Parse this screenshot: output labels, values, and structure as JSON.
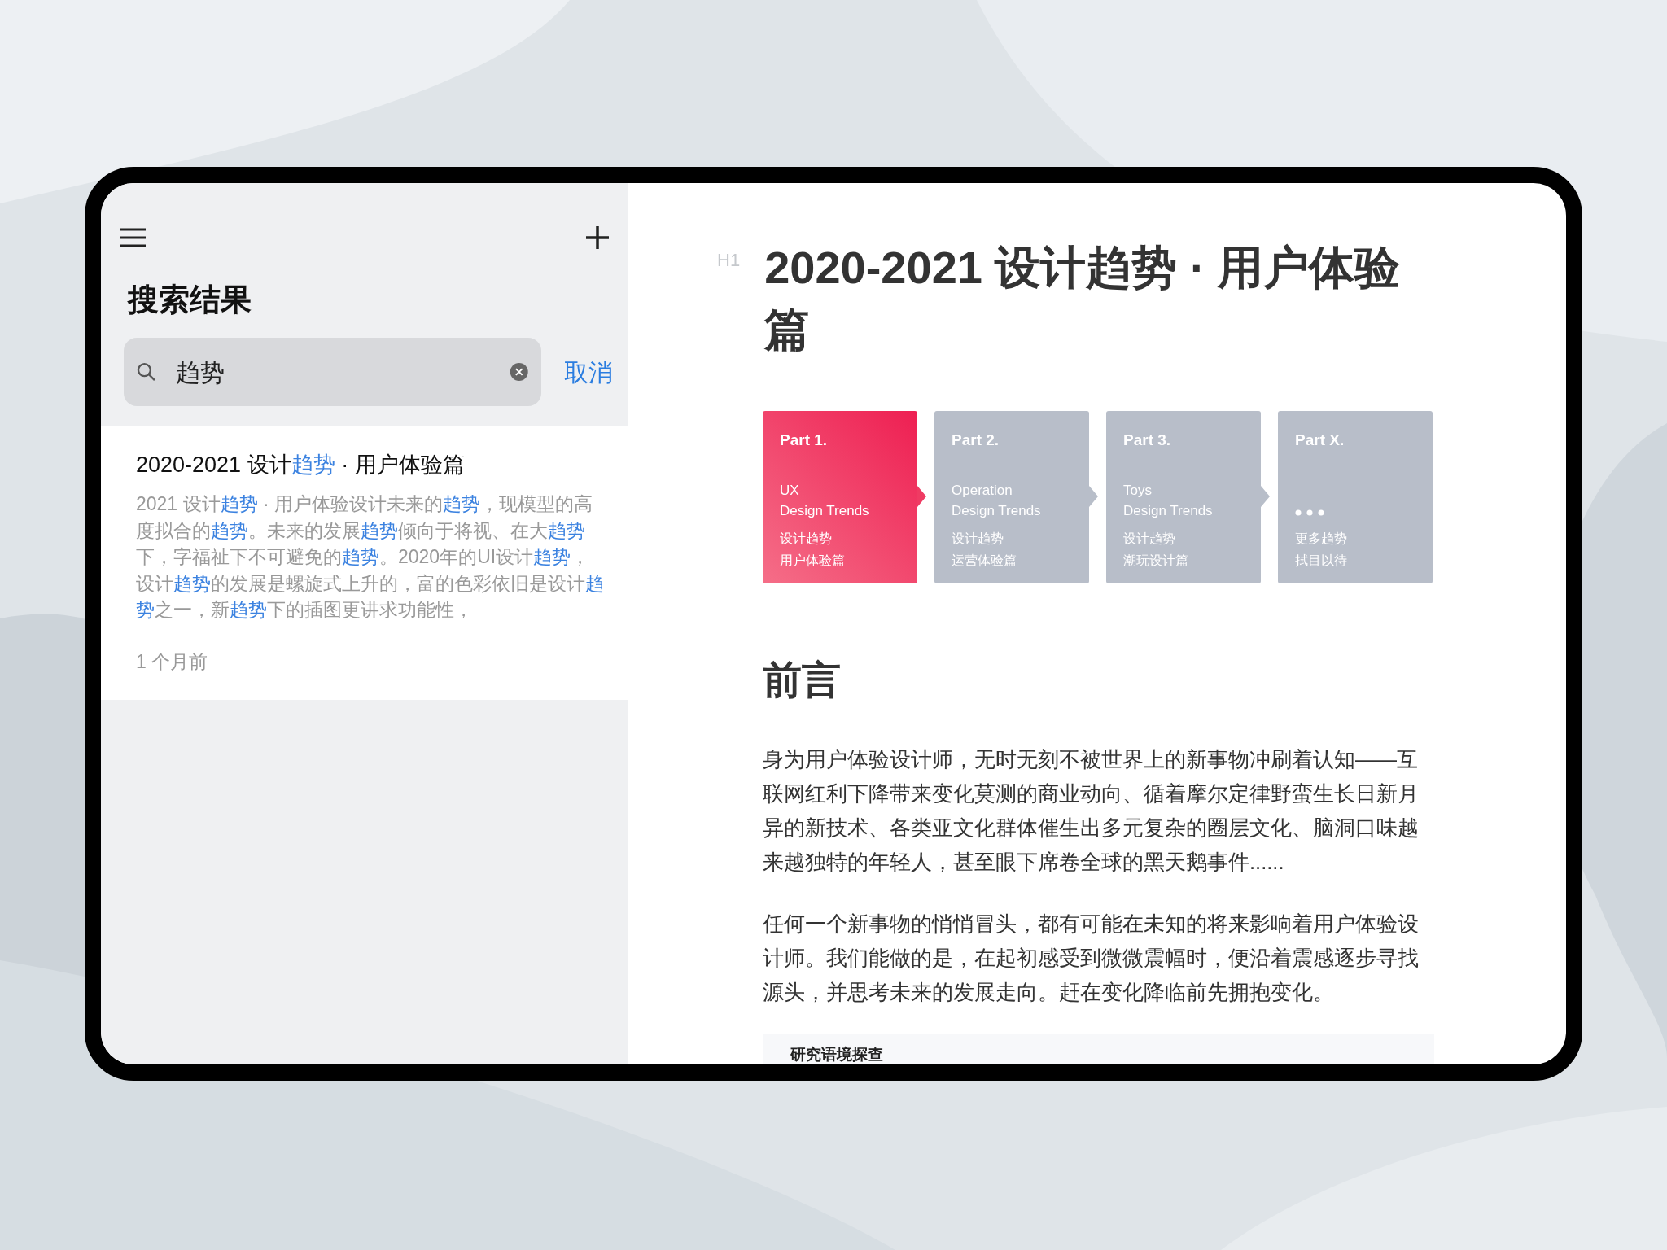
{
  "sidebar": {
    "title": "搜索结果",
    "search": {
      "value": "趋势"
    },
    "cancel": "取消",
    "results": [
      {
        "title": [
          {
            "text": "2020-2021 设计",
            "highlight": false
          },
          {
            "text": "趋势",
            "highlight": true
          },
          {
            "text": " · 用户体验篇",
            "highlight": false
          }
        ],
        "snippet": [
          {
            "text": "2021 设计",
            "highlight": false
          },
          {
            "text": "趋势",
            "highlight": true
          },
          {
            "text": " · 用户体验设计未来的",
            "highlight": false
          },
          {
            "text": "趋势",
            "highlight": true
          },
          {
            "text": "，现模型的高度拟合的",
            "highlight": false
          },
          {
            "text": "趋势",
            "highlight": true
          },
          {
            "text": "。未来的发展",
            "highlight": false
          },
          {
            "text": "趋势",
            "highlight": true
          },
          {
            "text": "倾向于将视、在大",
            "highlight": false
          },
          {
            "text": "趋势",
            "highlight": true
          },
          {
            "text": "下，字福祉下不可避免的",
            "highlight": false
          },
          {
            "text": "趋势",
            "highlight": true
          },
          {
            "text": "。2020年的UI设计",
            "highlight": false
          },
          {
            "text": "趋势",
            "highlight": true
          },
          {
            "text": "，设计",
            "highlight": false
          },
          {
            "text": "趋势",
            "highlight": true
          },
          {
            "text": "的发展是螺旋式上升的，富的色彩依旧是设计",
            "highlight": false
          },
          {
            "text": "趋势",
            "highlight": true
          },
          {
            "text": "之一，新",
            "highlight": false
          },
          {
            "text": "趋势",
            "highlight": true
          },
          {
            "text": "下的插图更讲求功能性，",
            "highlight": false
          }
        ],
        "time": "1 个月前"
      }
    ]
  },
  "document": {
    "heading_marker": "H1",
    "title": "2020-2021 设计趋势 · 用户体验篇",
    "parts": [
      {
        "kind": "topic",
        "selected": true,
        "part": "Part 1.",
        "lines": [
          "UX",
          "Design Trends"
        ],
        "sub": [
          "设计趋势",
          "用户体验篇"
        ]
      },
      {
        "kind": "topic",
        "selected": false,
        "part": "Part 2.",
        "lines": [
          "Operation",
          "Design Trends"
        ],
        "sub": [
          "设计趋势",
          "运营体验篇"
        ]
      },
      {
        "kind": "topic",
        "selected": false,
        "part": "Part 3.",
        "lines": [
          "Toys",
          "Design Trends"
        ],
        "sub": [
          "设计趋势",
          "潮玩设计篇"
        ]
      },
      {
        "kind": "more",
        "selected": false,
        "part": "Part X.",
        "sub": [
          "更多趋势",
          "拭目以待"
        ]
      }
    ],
    "section_title": "前言",
    "paragraphs": [
      "身为用户体验设计师，无时无刻不被世界上的新事物冲刷着认知——互联网红利下降带来变化莫测的商业动向、循着摩尔定律野蛮生长日新月异的新技术、各类亚文化群体催生出多元复杂的圈层文化、脑洞口味越来越独特的年轻人，甚至眼下席卷全球的黑天鹅事件......",
      "任何一个新事物的悄悄冒头，都有可能在未知的将来影响着用户体验设计师。我们能做的是，在起初感受到微微震幅时，便沿着震感逐步寻找源头，并思考未来的发展走向。赶在变化降临前先拥抱变化。"
    ],
    "box_title": "研究语境探查"
  }
}
